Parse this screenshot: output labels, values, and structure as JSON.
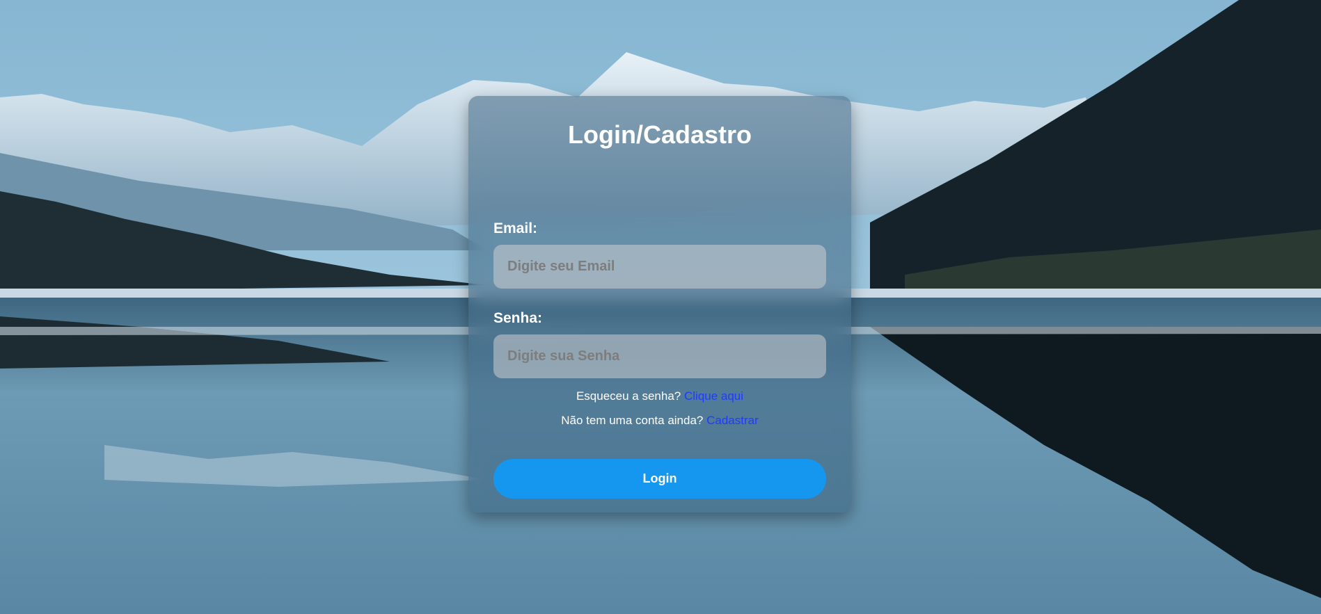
{
  "title": "Login/Cadastro",
  "email": {
    "label": "Email:",
    "placeholder": "Digite seu Email",
    "value": ""
  },
  "senha": {
    "label": "Senha:",
    "placeholder": "Digite sua Senha",
    "value": ""
  },
  "forgot": {
    "text": "Esqueceu a senha?",
    "link": "Clique aqui"
  },
  "register": {
    "text": "Não tem uma conta ainda?",
    "link": "Cadastrar"
  },
  "login_button": "Login",
  "colors": {
    "button": "#1597f0",
    "link": "#1f3bff",
    "text": "#ffffff"
  }
}
